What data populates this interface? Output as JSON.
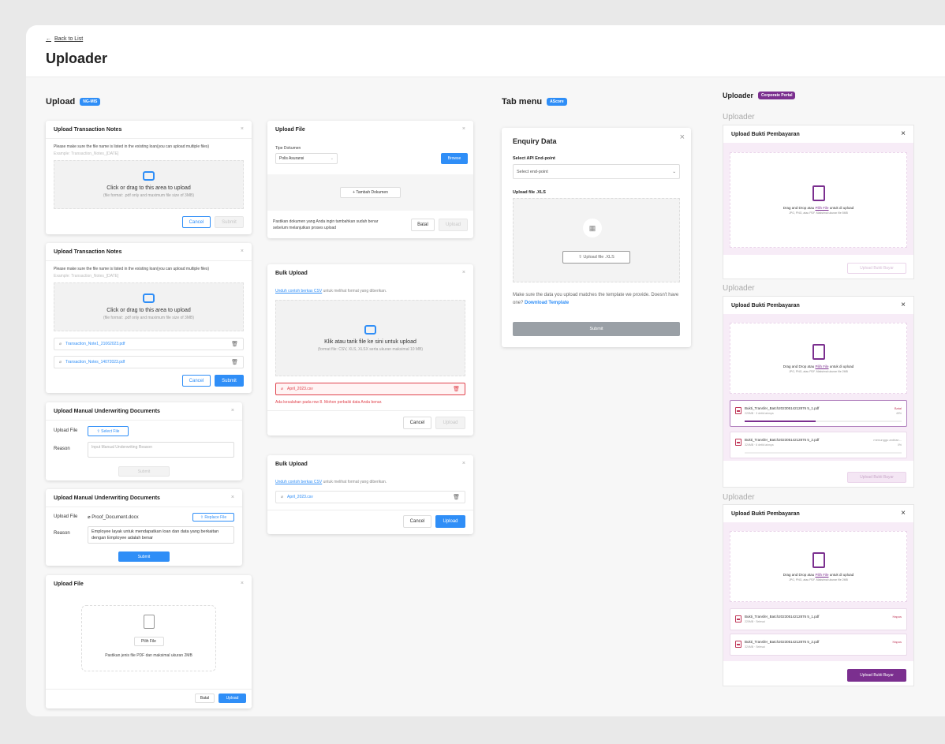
{
  "header": {
    "back": "Back to List",
    "title": "Uploader"
  },
  "col1": {
    "title": "Upload",
    "badge": "NG-MIS",
    "c1": {
      "title": "Upload Transaction Notes",
      "note": "Please make sure the file name is listed in the existing loan(you can upload multiple files)",
      "example": "Example: Transaction_Notes_[DATE]",
      "drop1": "Click or drag to this area to upload",
      "drop2": "(file format: .pdf only and maximum file size of 3MB)",
      "cancel": "Cancel",
      "submit": "Submit"
    },
    "c2": {
      "title": "Upload Transaction Notes",
      "note": "Please make sure the file name is listed in the existing loan(you can upload multiple files)",
      "example": "Example: Transaction_Notes_[DATE]",
      "drop1": "Click or drag to this area to upload",
      "drop2": "(file format: .pdf only and maximum file size of 3MB)",
      "file1": "Transaction_Note1_21062023.pdf",
      "file2": "Transaction_Notes_14072023.pdf",
      "cancel": "Cancel",
      "submit": "Submit"
    },
    "c3": {
      "title": "Upload Manual Underwriting Documents",
      "upload_label": "Upload File",
      "select": "Select File",
      "reason_label": "Reason",
      "reason_ph": "Input Manual Underwriting Reason",
      "submit": "Submit"
    },
    "c4": {
      "title": "Upload Manual Underwriting Documents",
      "upload_label": "Upload File",
      "file": "Proof_Document.docx",
      "replace": "Replace File",
      "reason_label": "Reason",
      "reason": "Employee layak untuk mendapatkan loan dan data yang berkaitan dengan Employee adalah benar",
      "submit": "Submit"
    },
    "c5": {
      "title": "Upload File",
      "pick": "Pilih File",
      "hint": "Pastikan jenis file PDF dan maksimal ukuran 2MB",
      "cancel": "Batal",
      "upload": "Upload"
    }
  },
  "col2": {
    "c1": {
      "title": "Upload File",
      "tipe_label": "Tipe Dokumen",
      "tipe": "Polis Asuransi",
      "browse": "Browse",
      "add": "+ Tambah Dokumen",
      "note": "Pastikan dokumen yang Anda ingin tambahkan sudah benar sebelum melanjutkan proses upload",
      "cancel": "Batal",
      "upload": "Upload"
    },
    "c2": {
      "title": "Bulk Upload",
      "link": "Unduh contoh berkas CSV",
      "link_rest": " untuk melihat format yang diberikan.",
      "drop1": "Klik atau tarik file ke sini untuk upload",
      "drop2": "(format file: CSV, XLS, XLSX serta ukuran maksimal 10 MB)",
      "file": "April_2023.csv",
      "error": "Ada kesalahan pada row 8. Mohon perbaiki data Anda benar.",
      "cancel": "Cancel",
      "upload": "Upload"
    },
    "c3": {
      "title": "Bulk Upload",
      "link": "Unduh contoh berkas CSV",
      "link_rest": " untuk melihat format yang diberikan.",
      "file": "April_2023.csv",
      "cancel": "Cancel",
      "upload": "Upload"
    }
  },
  "col3": {
    "title": "Tab menu",
    "badge": "AScore",
    "card": {
      "title": "Enquiry Data",
      "api_label": "Select API End-point",
      "api_ph": "Select end-point",
      "file_label": "Upload file .XLS",
      "upload_btn": "Upload file .XLS",
      "note": "Make sure the data you upload matches the template we provide. Doesn't have one?",
      "download": "Download Template",
      "submit": "Submit"
    }
  },
  "col4": {
    "title": "Uploader",
    "badge": "Corporate Portal",
    "u1": {
      "label": "Uploader",
      "title": "Upload Bukti Pembayaran",
      "drop_a": "Drag and Drop atau ",
      "drop_link": "Pilih File",
      "drop_b": " untuk di upload",
      "drop2": "JPG, PNG, atau PDF. Maksimal ukuran file 5MB",
      "button": "Upload Bukti Bayar"
    },
    "u2": {
      "label": "Uploader",
      "title": "Upload Bukti Pembayaran",
      "drop_a": "Drag and Drop atau ",
      "drop_link": "Pilih File",
      "drop_b": " untuk di upload",
      "drop2": "JPG, PNG, atau PDF. Maksimal ukuran file 2MB",
      "f1": "Bukti_Transfer_Batch20230514212876 5_1.pdf",
      "f1s": "220MB · 3 detik lainnya",
      "f1st": "Batal",
      "f1p": "45%",
      "f1prog": 0.45,
      "f2": "Bukti_Transfer_Batch20230514212876 5_2.pdf",
      "f2s": "324MB · 6 detik lainnya",
      "f2st": "menunggu antrian...",
      "f2p": "0%",
      "button": "Upload Bukti Bayar"
    },
    "u3": {
      "label": "Uploader",
      "title": "Upload Bukti Pembayaran",
      "drop_a": "Drag and Drop atau ",
      "drop_link": "Pilih File",
      "drop_b": " untuk di upload",
      "drop2": "JPG, PNG, atau PDF. Maksimal ukuran file 2MB",
      "f1": "Bukti_Transfer_Batch20230514212876 5_1.pdf",
      "f1s": "220MB · Selesai",
      "f2": "Bukti_Transfer_Batch20230514212876 5_2.pdf",
      "f2s": "324MB · Selesai",
      "del": "Hapus",
      "button": "Upload Bukti Bayar"
    }
  },
  "colors": {
    "blue": "#2f8ef7",
    "purple": "#7b2f8f",
    "error": "#e0444e"
  }
}
